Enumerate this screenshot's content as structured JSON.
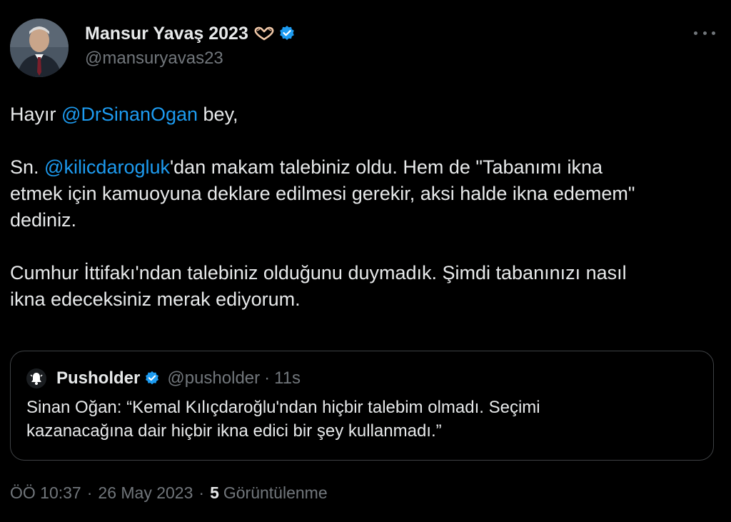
{
  "author": {
    "display_name": "Mansur Yavaş 2023",
    "handle": "@mansuryavas23",
    "verified": true,
    "name_emoji": "heart-hands-emoji"
  },
  "tweet": {
    "line1_prefix": "Hayır ",
    "line1_mention": "@DrSinanOgan",
    "line1_suffix": " bey,",
    "p2_prefix": "Sn. ",
    "p2_mention": "@kilicdarogluk",
    "p2_line1_rest": "'dan makam talebiniz oldu. Hem de \"Tabanımı ikna",
    "p2_line2": "etmek için kamuoyuna deklare edilmesi gerekir, aksi halde ikna edemem\"",
    "p2_line3": "dediniz.",
    "p3_line1": "Cumhur İttifakı'ndan talebiniz olduğunu duymadık. Şimdi tabanınızı nasıl",
    "p3_line2": "ikna edeceksiniz merak ediyorum."
  },
  "quote": {
    "name": "Pusholder",
    "handle": "@pusholder",
    "separator": "·",
    "time": "11s",
    "verified": true,
    "line1": "Sinan Oğan: “Kemal Kılıçdaroğlu'ndan hiçbir talebim olmadı. Seçimi",
    "line2": "kazanacağına dair hiçbir ikna edici bir şey kullanmadı.”"
  },
  "meta": {
    "time": "ÖÖ 10:37",
    "separator": "·",
    "date": "26 May 2023",
    "views_count": "5",
    "views_label": "Görüntülenme"
  },
  "colors": {
    "background": "#000000",
    "text": "#e7e9ea",
    "secondary": "#71767b",
    "link": "#1d9bf0",
    "border": "#3e4144",
    "verified": "#1d9bf0"
  }
}
